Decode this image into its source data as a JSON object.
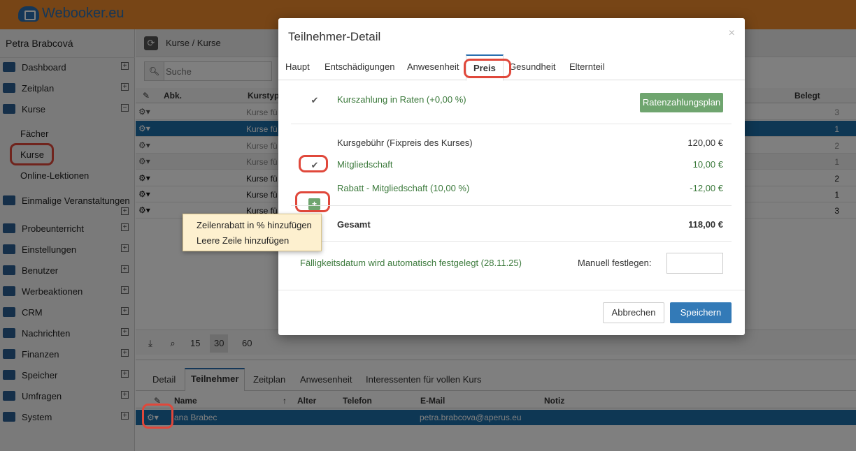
{
  "app": {
    "logo": "Webooker.eu"
  },
  "sidebar": {
    "user": "Petra Brabcová",
    "items": [
      {
        "label": "Dashboard"
      },
      {
        "label": "Zeitplan"
      },
      {
        "label": "Kurse"
      },
      {
        "label": "Einmalige Veranstaltungen"
      },
      {
        "label": "Probeunterricht"
      },
      {
        "label": "Einstellungen"
      },
      {
        "label": "Benutzer"
      },
      {
        "label": "Werbeaktionen"
      },
      {
        "label": "CRM"
      },
      {
        "label": "Nachrichten"
      },
      {
        "label": "Finanzen"
      },
      {
        "label": "Speicher"
      },
      {
        "label": "Umfragen"
      },
      {
        "label": "System"
      }
    ],
    "subitems": [
      "Fächer",
      "Kurse",
      "Online-Lektionen"
    ]
  },
  "breadcrumb": "Kurse / Kurse",
  "search": {
    "placeholder": "Suche"
  },
  "grid": {
    "headers": {
      "abk": "Abk.",
      "kurstyp": "Kurstyp",
      "belegt": "Belegt"
    },
    "rows": [
      {
        "kurs": "Kurse fü",
        "belegt": "3"
      },
      {
        "kurs": "Kurse fü",
        "belegt": "1"
      },
      {
        "kurs": "Kurse fü",
        "belegt": "2"
      },
      {
        "kurs": "Kurse fü",
        "belegt": "1"
      },
      {
        "kurs": "Kurse fü",
        "belegt": "2"
      },
      {
        "kurs": "Kurse fü",
        "belegt": "1"
      },
      {
        "kurs": "Kurse fü",
        "belegt": "3"
      }
    ]
  },
  "pager": {
    "sizes": [
      "15",
      "30",
      "60"
    ],
    "active": "30"
  },
  "bottom": {
    "tabs": [
      "Detail",
      "Teilnehmer",
      "Zeitplan",
      "Anwesenheit",
      "Interessenten für vollen Kurs"
    ],
    "headers": {
      "name": "Name",
      "alter": "Alter",
      "telefon": "Telefon",
      "email": "E-Mail",
      "notiz": "Notiz"
    },
    "row": {
      "name": "ana Brabec",
      "email": "petra.brabcova@aperus.eu"
    }
  },
  "modal": {
    "title": "Teilnehmer-Detail",
    "close": "×",
    "tabs": [
      "Haupt",
      "Entschädigungen",
      "Anwesenheit",
      "Preis",
      "Gesundheit",
      "Elternteil"
    ],
    "installments": {
      "label": "Kurszahlung in Raten (+0,00 %)",
      "button": "Ratenzahlungsplan"
    },
    "lines": [
      {
        "label": "Kursgebühr (Fixpreis des Kurses)",
        "amount": "120,00 €"
      },
      {
        "label": "Mitgliedschaft",
        "amount": "10,00 €"
      },
      {
        "label": "Rabatt - Mitgliedschaft (10,00 %)",
        "amount": "-12,00 €"
      }
    ],
    "total": {
      "label": "Gesamt",
      "amount": "118,00 €"
    },
    "due": {
      "label": "Fälligkeitsdatum wird automatisch festgelegt (28.11.25)",
      "manual": "Manuell festlegen:"
    },
    "buttons": {
      "cancel": "Abbrechen",
      "save": "Speichern"
    }
  },
  "popup": {
    "items": [
      "Zeilenrabatt in % hinzufügen",
      "Leere Zeile hinzufügen"
    ]
  }
}
